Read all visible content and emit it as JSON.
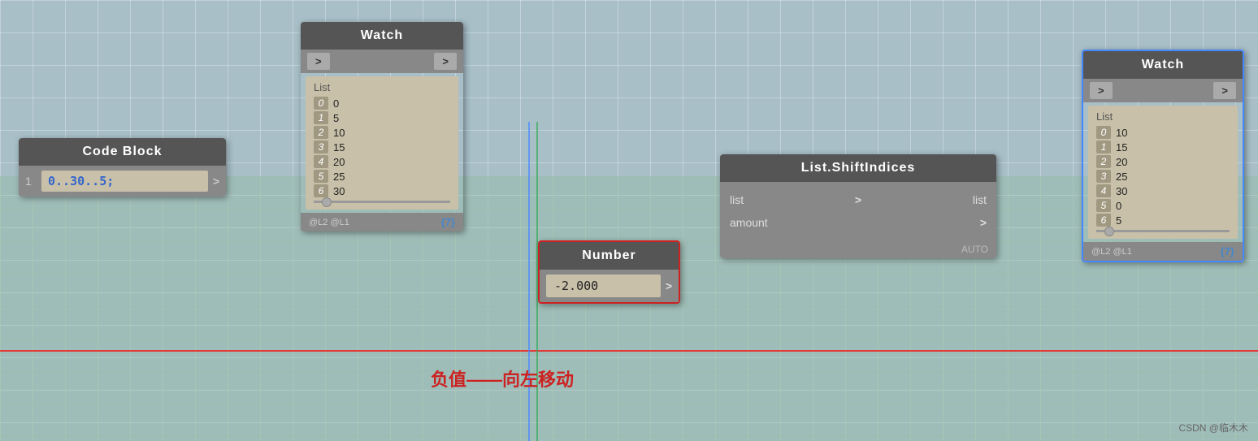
{
  "background": {
    "color": "#a8bfc8"
  },
  "nodes": {
    "code_block": {
      "header": "Code Block",
      "index": "1",
      "code": "0..30..5;",
      "port": ">"
    },
    "watch1": {
      "header": "Watch",
      "port_left": ">",
      "port_right": ">",
      "list_title": "List",
      "items": [
        {
          "index": "0",
          "value": "0"
        },
        {
          "index": "1",
          "value": "5"
        },
        {
          "index": "2",
          "value": "10"
        },
        {
          "index": "3",
          "value": "15"
        },
        {
          "index": "4",
          "value": "20"
        },
        {
          "index": "5",
          "value": "25"
        },
        {
          "index": "6",
          "value": "30"
        }
      ],
      "footer_left": "@L2 @L1",
      "footer_count": "{7}"
    },
    "watch2": {
      "header": "Watch",
      "port_left": ">",
      "port_right": ">",
      "list_title": "List",
      "items": [
        {
          "index": "0",
          "value": "10"
        },
        {
          "index": "1",
          "value": "15"
        },
        {
          "index": "2",
          "value": "20"
        },
        {
          "index": "3",
          "value": "25"
        },
        {
          "index": "4",
          "value": "30"
        },
        {
          "index": "5",
          "value": "0"
        },
        {
          "index": "6",
          "value": "5"
        }
      ],
      "footer_left": "@L2 @L1",
      "footer_count": "{7}"
    },
    "list_shift": {
      "header": "List.ShiftIndices",
      "port_list_in": "list",
      "port_amount_in": "amount",
      "port_arrow_list": ">",
      "port_arrow_amount": ">",
      "port_list_out": "list",
      "auto": "AUTO"
    },
    "number": {
      "header": "Number",
      "value": "-2.000",
      "port": ">"
    }
  },
  "annotation": {
    "text": "负值——向左移动"
  },
  "watermark": {
    "text": "CSDN @临木木"
  }
}
